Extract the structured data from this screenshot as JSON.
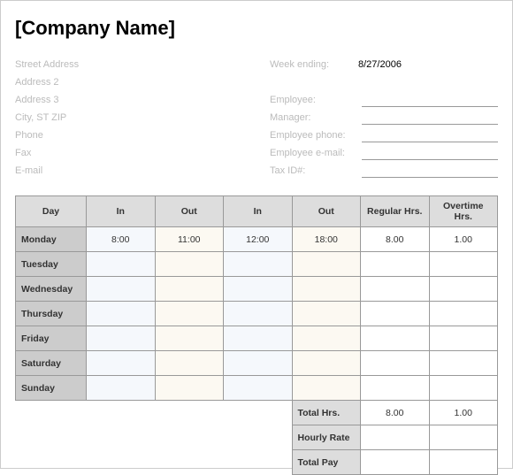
{
  "title": "[Company Name]",
  "address": {
    "street": "Street Address",
    "line2": "Address 2",
    "line3": "Address 3",
    "cityStZip": "City, ST  ZIP",
    "phone": "Phone",
    "fax": "Fax",
    "email": "E-mail"
  },
  "meta": {
    "weekEndingLabel": "Week ending:",
    "weekEndingValue": "8/27/2006",
    "employeeLabel": "Employee:",
    "managerLabel": "Manager:",
    "empPhoneLabel": "Employee phone:",
    "empEmailLabel": "Employee e-mail:",
    "taxIdLabel": "Tax ID#:"
  },
  "headers": {
    "day": "Day",
    "in1": "In",
    "out1": "Out",
    "in2": "In",
    "out2": "Out",
    "reg": "Regular Hrs.",
    "ot": "Overtime Hrs."
  },
  "rows": [
    {
      "day": "Monday",
      "in1": "8:00",
      "out1": "11:00",
      "in2": "12:00",
      "out2": "18:00",
      "reg": "8.00",
      "ot": "1.00"
    },
    {
      "day": "Tuesday",
      "in1": "",
      "out1": "",
      "in2": "",
      "out2": "",
      "reg": "",
      "ot": ""
    },
    {
      "day": "Wednesday",
      "in1": "",
      "out1": "",
      "in2": "",
      "out2": "",
      "reg": "",
      "ot": ""
    },
    {
      "day": "Thursday",
      "in1": "",
      "out1": "",
      "in2": "",
      "out2": "",
      "reg": "",
      "ot": ""
    },
    {
      "day": "Friday",
      "in1": "",
      "out1": "",
      "in2": "",
      "out2": "",
      "reg": "",
      "ot": ""
    },
    {
      "day": "Saturday",
      "in1": "",
      "out1": "",
      "in2": "",
      "out2": "",
      "reg": "",
      "ot": ""
    },
    {
      "day": "Sunday",
      "in1": "",
      "out1": "",
      "in2": "",
      "out2": "",
      "reg": "",
      "ot": ""
    }
  ],
  "totals": {
    "totalHrsLabel": "Total Hrs.",
    "totalHrsReg": "8.00",
    "totalHrsOt": "1.00",
    "hourlyRateLabel": "Hourly Rate",
    "hourlyRateReg": "",
    "hourlyRateOt": "",
    "totalPayLabel": "Total Pay",
    "totalPayReg": "",
    "totalPayOt": ""
  }
}
